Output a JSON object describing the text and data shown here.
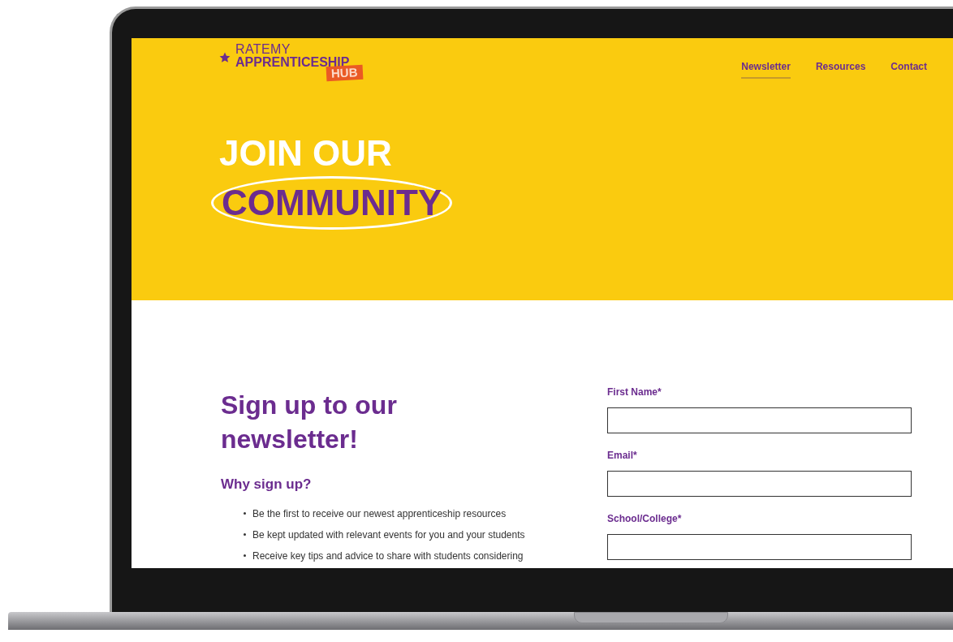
{
  "logo": {
    "top": "RATEMY",
    "main": "APPRENTICESHIP",
    "badge": "HUB"
  },
  "nav": [
    {
      "label": "Newsletter",
      "selected": true
    },
    {
      "label": "Resources",
      "selected": false
    },
    {
      "label": "Contact",
      "selected": false
    }
  ],
  "hero": {
    "line1": "JOIN OUR",
    "line2": "COMMUNITY"
  },
  "signup": {
    "heading": "Sign up to our newsletter!",
    "subheading": "Why sign up?",
    "bullets": [
      "Be the first to receive our newest apprenticeship resources",
      "Be kept updated with relevant events for you and your students",
      "Receive key tips and advice to share with students considering"
    ]
  },
  "form": {
    "fields": [
      {
        "label": "First Name*"
      },
      {
        "label": "Email*"
      },
      {
        "label": "School/College*"
      }
    ]
  }
}
